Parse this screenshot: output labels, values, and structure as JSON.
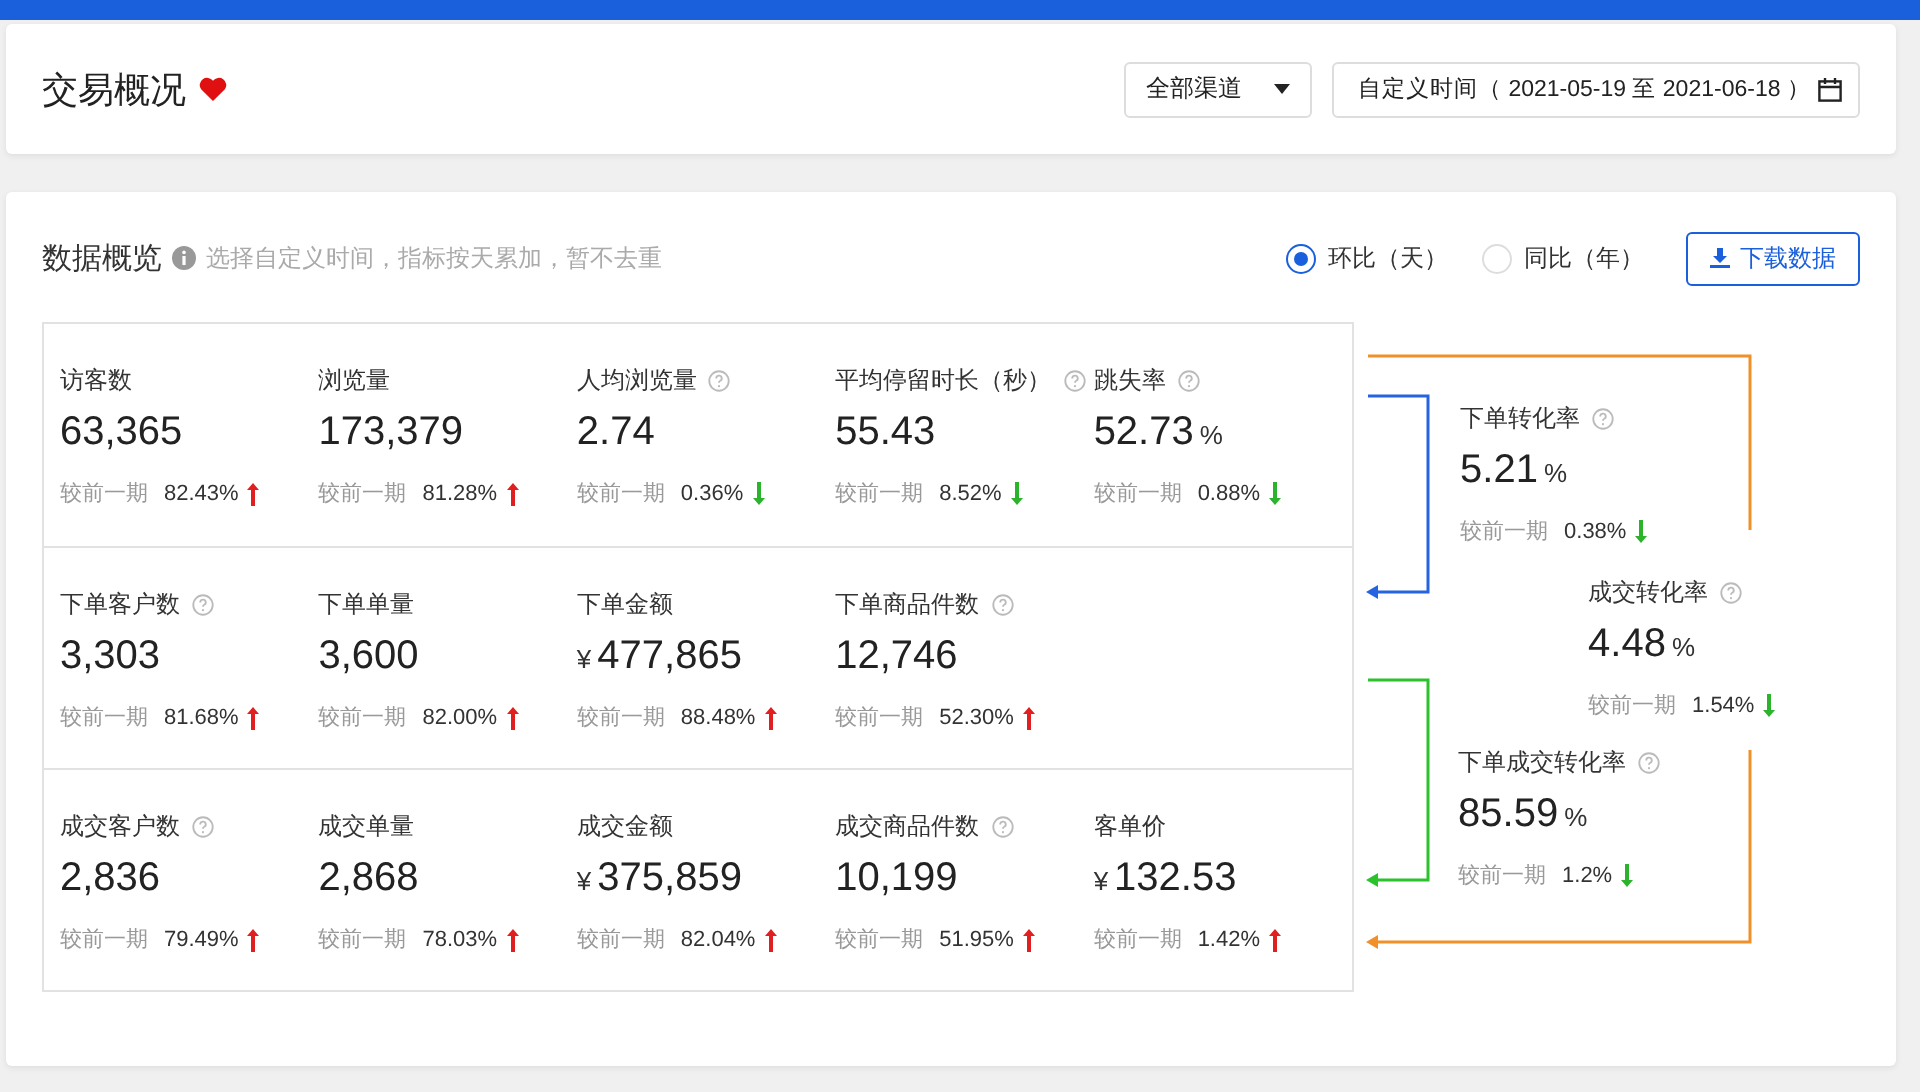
{
  "header": {
    "title": "交易概况",
    "favorite": true,
    "channel_select": {
      "value": "全部渠道"
    },
    "date_range": {
      "value": "自定义时间（ 2021-05-19 至 2021-06-18 ）"
    }
  },
  "overview": {
    "title": "数据概览",
    "hint": "选择自定义时间，指标按天累加，暂不去重",
    "compare_modes": [
      {
        "label": "环比（天）",
        "selected": true
      },
      {
        "label": "同比（年）",
        "selected": false
      }
    ],
    "download_button": "下载数据",
    "rows": [
      {
        "metrics": [
          {
            "label": "访客数",
            "help": false,
            "value": "63,365",
            "compare": "较前一期",
            "change": "82.43%",
            "up": true
          },
          {
            "label": "浏览量",
            "help": false,
            "value": "173,379",
            "compare": "较前一期",
            "change": "81.28%",
            "up": true
          },
          {
            "label": "人均浏览量",
            "help": true,
            "value": "2.74",
            "compare": "较前一期",
            "change": "0.36%",
            "up": false
          },
          {
            "label": "平均停留时长（秒）",
            "help": true,
            "value": "55.43",
            "compare": "较前一期",
            "change": "8.52%",
            "up": false
          },
          {
            "label": "跳失率",
            "help": true,
            "value": "52.73",
            "unit": "%",
            "compare": "较前一期",
            "change": "0.88%",
            "up": false
          }
        ]
      },
      {
        "metrics": [
          {
            "label": "下单客户数",
            "help": true,
            "value": "3,303",
            "compare": "较前一期",
            "change": "81.68%",
            "up": true
          },
          {
            "label": "下单单量",
            "help": false,
            "value": "3,600",
            "compare": "较前一期",
            "change": "82.00%",
            "up": true
          },
          {
            "label": "下单金额",
            "help": false,
            "currency": "¥",
            "value": "477,865",
            "compare": "较前一期",
            "change": "88.48%",
            "up": true
          },
          {
            "label": "下单商品件数",
            "help": true,
            "value": "12,746",
            "compare": "较前一期",
            "change": "52.30%",
            "up": true
          }
        ]
      },
      {
        "metrics": [
          {
            "label": "成交客户数",
            "help": true,
            "value": "2,836",
            "compare": "较前一期",
            "change": "79.49%",
            "up": true
          },
          {
            "label": "成交单量",
            "help": false,
            "value": "2,868",
            "compare": "较前一期",
            "change": "78.03%",
            "up": true
          },
          {
            "label": "成交金额",
            "help": false,
            "currency": "¥",
            "value": "375,859",
            "compare": "较前一期",
            "change": "82.04%",
            "up": true
          },
          {
            "label": "成交商品件数",
            "help": true,
            "value": "10,199",
            "compare": "较前一期",
            "change": "51.95%",
            "up": true
          },
          {
            "label": "客单价",
            "help": false,
            "currency": "¥",
            "value": "132.53",
            "compare": "较前一期",
            "change": "1.42%",
            "up": true
          }
        ]
      }
    ],
    "rates": [
      {
        "label": "下单转化率",
        "help": true,
        "value": "5.21",
        "unit": "%",
        "compare": "较前一期",
        "change": "0.38%",
        "up": false
      },
      {
        "label": "成交转化率",
        "help": true,
        "value": "4.48",
        "unit": "%",
        "compare": "较前一期",
        "change": "1.54%",
        "up": false
      },
      {
        "label": "下单成交转化率",
        "help": true,
        "value": "85.59",
        "unit": "%",
        "compare": "较前一期",
        "change": "1.2%",
        "up": false
      }
    ]
  }
}
